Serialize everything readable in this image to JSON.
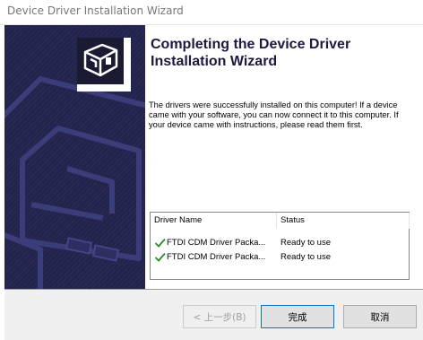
{
  "window": {
    "title": "Device Driver Installation Wizard"
  },
  "heading": "Completing the Device Driver Installation Wizard",
  "description": "The drivers were successfully installed on this computer! If a device came with your software, you can now connect it to this computer. If your device came with instructions, please read them first.",
  "driver_list": {
    "columns": [
      "Driver Name",
      "Status"
    ],
    "rows": [
      {
        "name": "FTDI CDM Driver Packa...",
        "status": "Ready to use",
        "icon": "green-check-icon"
      },
      {
        "name": "FTDI CDM Driver Packa...",
        "status": "Ready to use",
        "icon": "green-check-icon"
      }
    ]
  },
  "buttons": {
    "back": "< 上一步(B)",
    "finish": "完成",
    "cancel": "取消"
  },
  "colors": {
    "banner_bg": "#1f2045",
    "heading_text": "#1a1a40",
    "check_green": "#2e8b2e",
    "accent_border": "#0078d7"
  }
}
